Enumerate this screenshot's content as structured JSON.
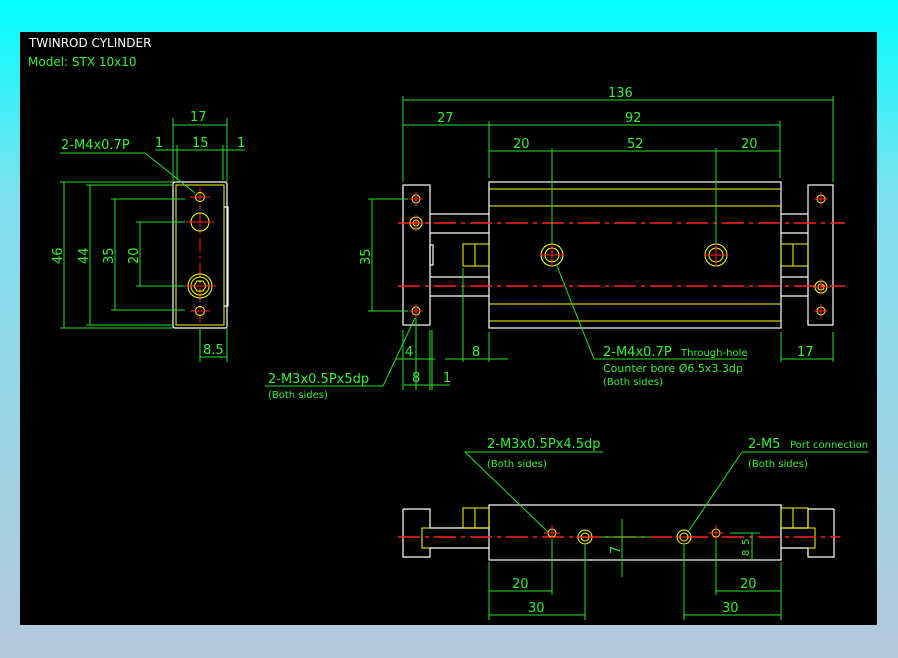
{
  "title": "TWINROD CYLINDER",
  "model": "Model: STX 10x10",
  "colors": {
    "background": "#000000",
    "dimension": "#22e022",
    "outline": "#ffffff",
    "feature": "#ffff00",
    "centerline": "#ff2020"
  },
  "side_view": {
    "dims": {
      "width": "17",
      "left_gap": "1",
      "inner": "15",
      "right_gap": "1",
      "h46": "46",
      "h44": "44",
      "h35": "35",
      "h20": "20",
      "offset": "8.5"
    },
    "callout": "2-M4x0.7P"
  },
  "front_view": {
    "dims": {
      "overall": "136",
      "rod_ext": "27",
      "body": "92",
      "d20a": "20",
      "d52": "52",
      "d20b": "20",
      "h35": "35",
      "d4": "4",
      "d8": "8",
      "d8b": "8",
      "d1": "1",
      "d17": "17"
    },
    "callout_mount": {
      "line1": "2-M3x0.5Px5dp",
      "line2": "(Both sides)"
    },
    "callout_thru": {
      "line1a": "2-M4x0.7P",
      "line1b": "Through-hole",
      "line2": "Counter bore Ø6.5x3.3dp",
      "line3": "(Both sides)"
    }
  },
  "bottom_view": {
    "dims": {
      "l20": "20",
      "l30": "30",
      "r20": "20",
      "r30": "30",
      "v7": "7",
      "v5": "5",
      "v8": "8"
    },
    "callout_tap": {
      "line1": "2-M3x0.5Px4.5dp",
      "line2": "(Both sides)"
    },
    "callout_port": {
      "line1a": "2-M5",
      "line1b": "Port connection",
      "line2": "(Both sides)"
    }
  }
}
